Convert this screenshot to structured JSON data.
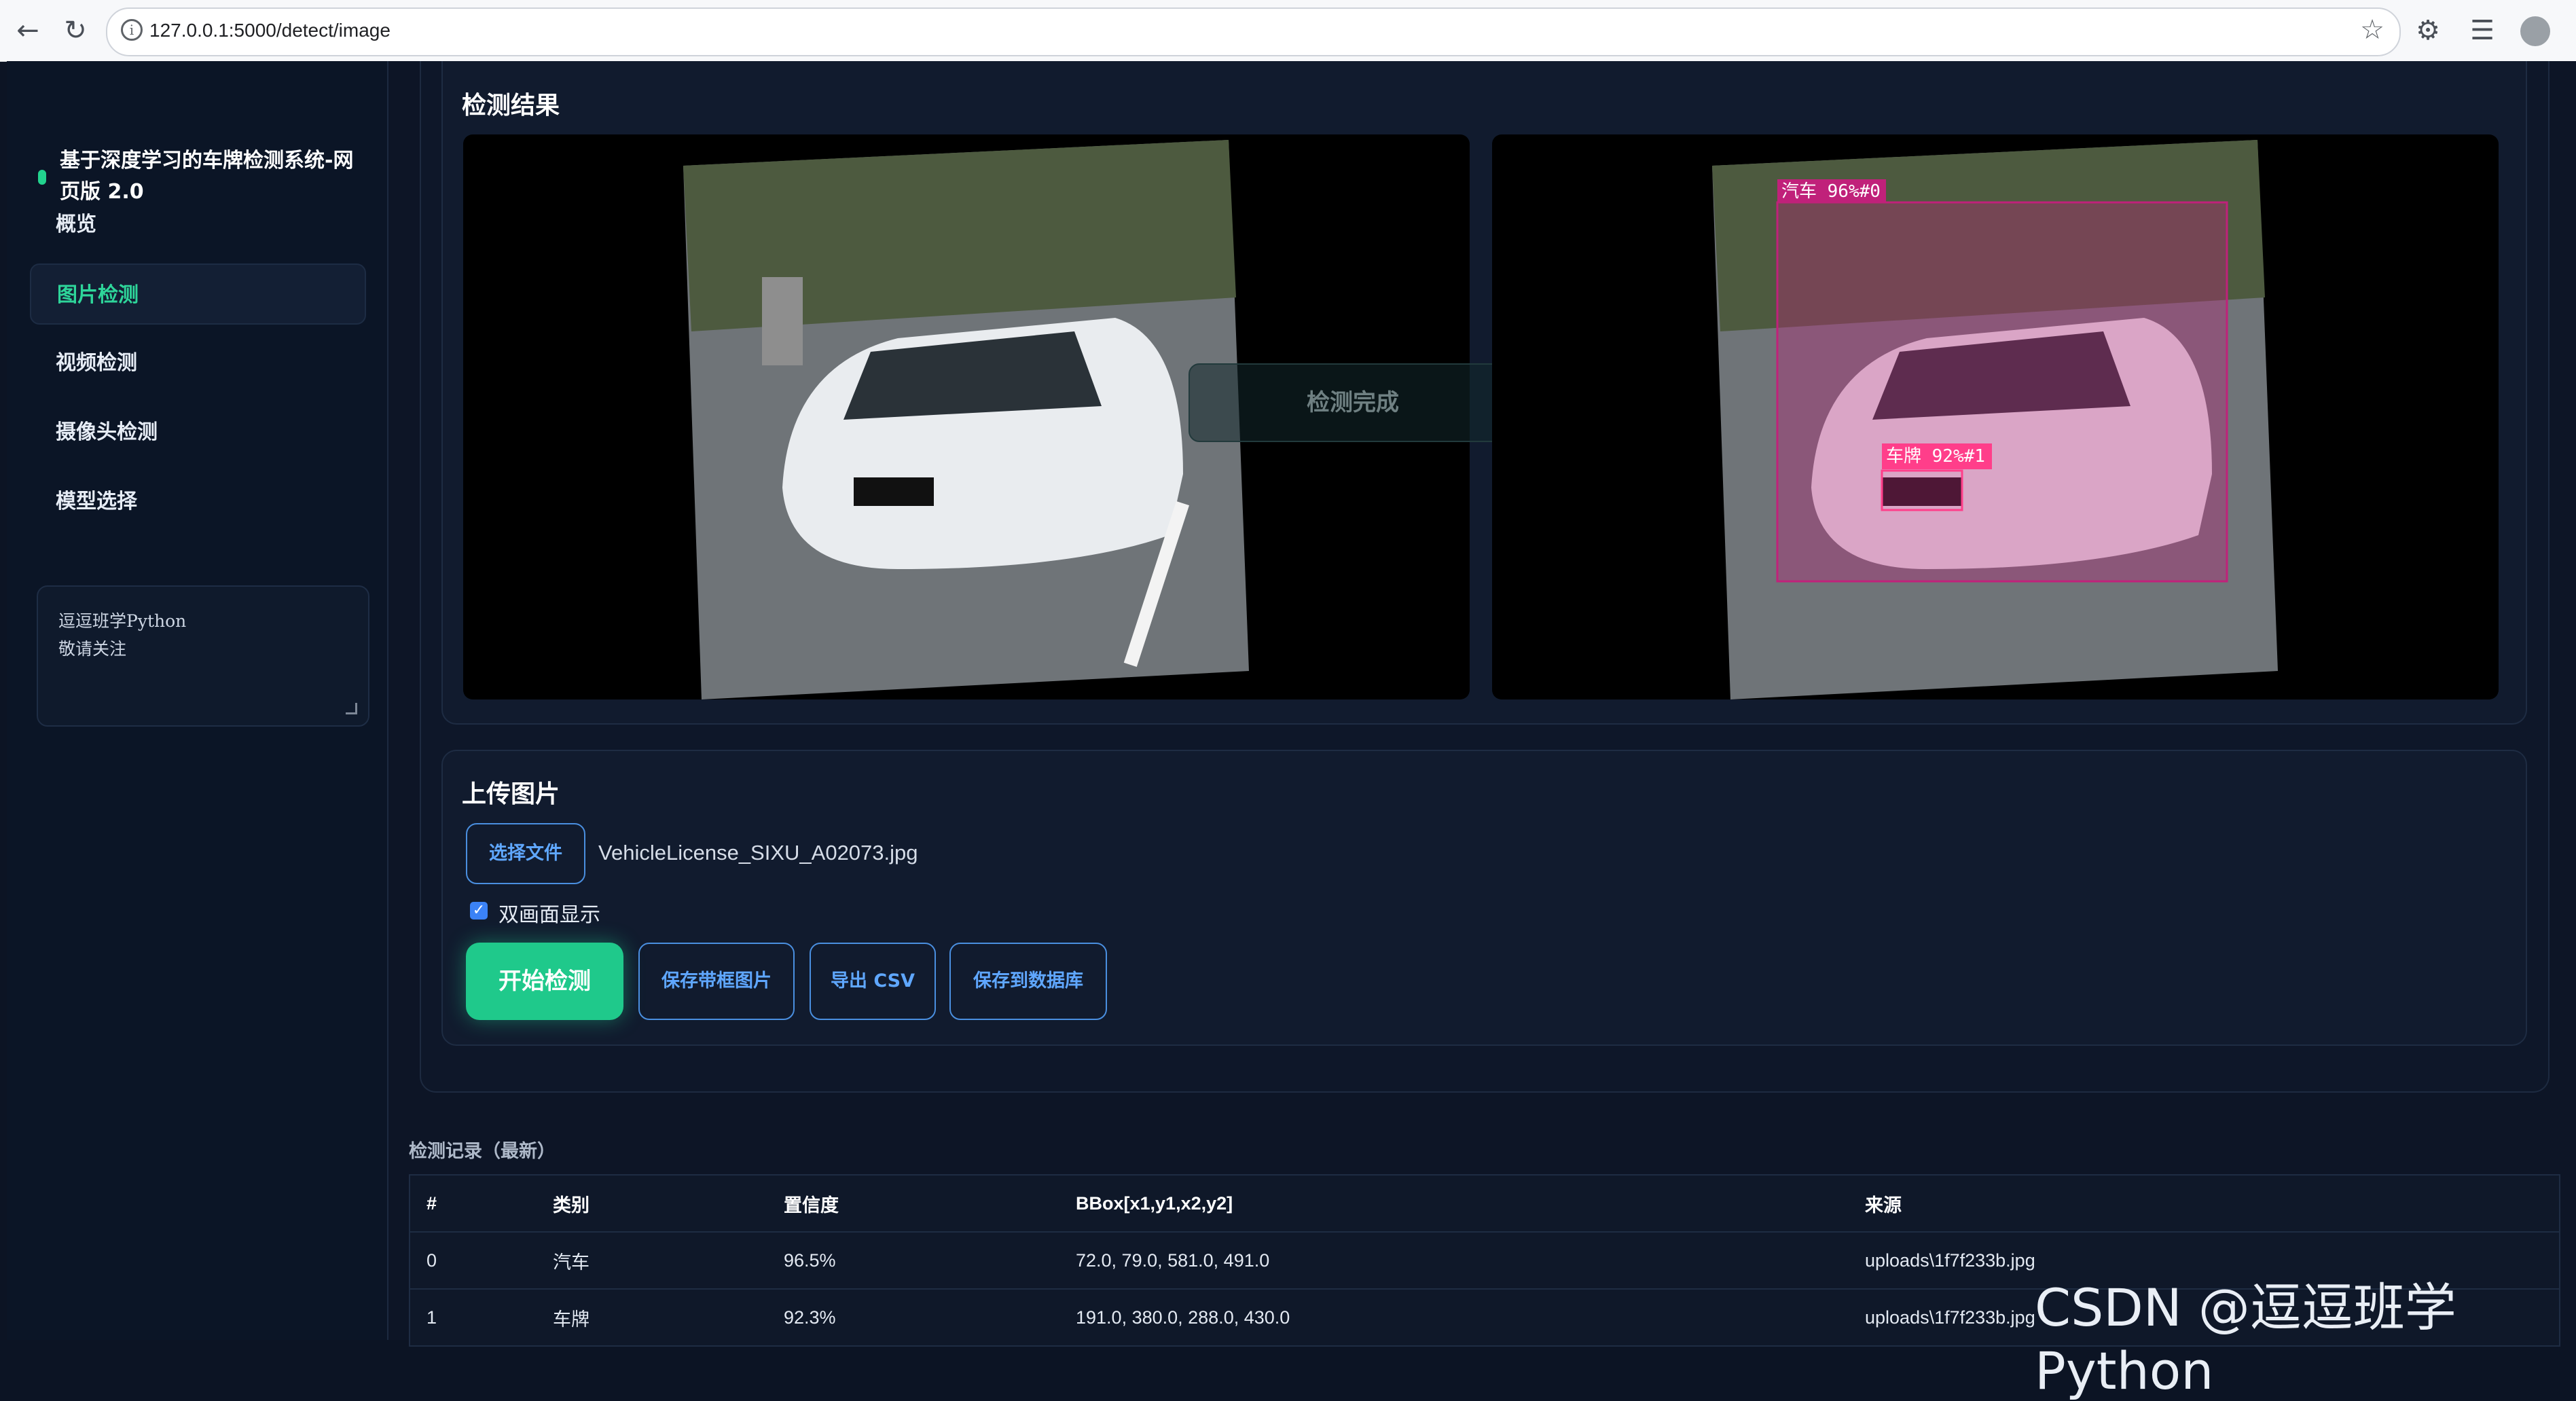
{
  "browser": {
    "url": "127.0.0.1:5000/detect/image",
    "back_icon": "arrow-left-icon",
    "reload_icon": "reload-icon"
  },
  "sidebar": {
    "brand": "基于深度学习的车牌检测系统-网页版 2.0",
    "items": [
      {
        "label": "概览",
        "active": false
      },
      {
        "label": "图片检测",
        "active": true
      },
      {
        "label": "视频检测",
        "active": false
      },
      {
        "label": "摄像头检测",
        "active": false
      },
      {
        "label": "模型选择",
        "active": false
      }
    ],
    "note": "逗逗班学Python\n敬请关注"
  },
  "result": {
    "title": "检测结果",
    "status_badge": "检测完成",
    "detections": [
      {
        "label": "汽车 96%#0",
        "color": "#c0217a"
      },
      {
        "label": "车牌 92%#1",
        "color": "#ff3e8a"
      }
    ]
  },
  "upload": {
    "title": "上传图片",
    "choose_file": "选择文件",
    "file_name": "VehicleLicense_SIXU_A02073.jpg",
    "dual_view_label": "双画面显示",
    "dual_view_checked": true,
    "start": "开始检测",
    "save_boxed": "保存带框图片",
    "export_csv": "导出 CSV",
    "save_db": "保存到数据库"
  },
  "records": {
    "title": "检测记录（最新）",
    "columns": [
      "#",
      "类别",
      "置信度",
      "BBox[x1,y1,x2,y2]",
      "来源"
    ],
    "rows": [
      [
        "0",
        "汽车",
        "96.5%",
        "72.0, 79.0, 581.0, 491.0",
        "uploads\\1f7f233b.jpg"
      ],
      [
        "1",
        "车牌",
        "92.3%",
        "191.0, 380.0, 288.0, 430.0",
        "uploads\\1f7f233b.jpg"
      ]
    ]
  },
  "watermark": "CSDN @逗逗班学Python",
  "colors": {
    "accent": "#1fc98b",
    "primary_button": "#4a8fe0",
    "background": "#0c1424"
  }
}
